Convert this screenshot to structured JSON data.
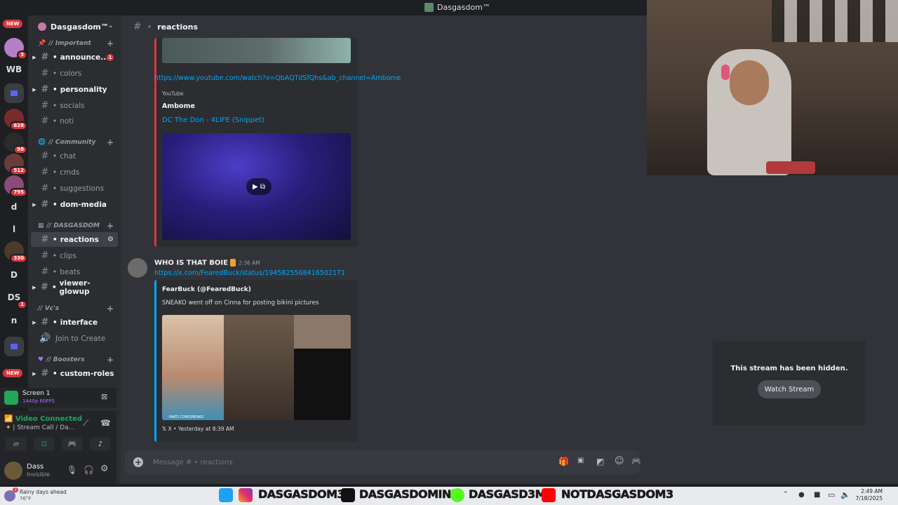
{
  "window": {
    "title": "Dasgasdom™"
  },
  "rail": {
    "new_top": "NEW",
    "new_bottom": "NEW",
    "items": [
      {
        "label": "WB"
      },
      {
        "badge": "3"
      },
      {
        "badge": "628"
      },
      {
        "badge": "98"
      },
      {
        "badge": "512"
      },
      {
        "badge": "795"
      },
      {
        "label": "d"
      },
      {
        "label": "l"
      },
      {
        "badge": "330"
      },
      {
        "label": "D"
      },
      {
        "label": "DS",
        "badge": "1"
      },
      {
        "label": "n"
      }
    ]
  },
  "server": {
    "name": "Dasgasdom™"
  },
  "categories": {
    "important": "// Important",
    "community": "// Community",
    "dasgasdom": "// DASGASDOM",
    "vcs": "// Vc's",
    "boosters": "// Boosters"
  },
  "channels": {
    "announcements": {
      "name": "announce...",
      "unread": "1"
    },
    "colors": "colors",
    "personality": "personality",
    "socials": "socials",
    "noti": "noti",
    "chat": "chat",
    "cmds": "cmds",
    "suggestions": "suggestions",
    "dom_media": "dom-media",
    "reactions": "reactions",
    "clips": "clips",
    "beats": "beats",
    "viewer_glowup": "viewer-glowup",
    "interface": "interface",
    "join_to_create": "Join to Create",
    "custom_roles": "custom-roles"
  },
  "screen_share": {
    "title": "Screen 1",
    "quality": "1440p 60FPS"
  },
  "voice": {
    "status": "Video Connected",
    "channel": "Stream Call / Da..."
  },
  "user": {
    "name": "Dass",
    "status": "Invisible"
  },
  "chat": {
    "channel": "reactions",
    "yt_link": "https://www.youtube.com/watch?v=QbAQTdSfQhs&ab_channel=Ambome",
    "yt_embed": {
      "provider": "YouTube",
      "author": "Ambome",
      "title": "DC The Don - 4LIFE (Snippet)"
    },
    "message": {
      "author": "WHO IS THAT BOIE",
      "time": "2:36 AM",
      "link": "https://x.com/FearedBuck/status/1945825568416502171"
    },
    "x_embed": {
      "author": "FearBuck (@FearedBuck)",
      "description": "SNEAKO went off on Cinna for posting bikini pictures",
      "watermark": "PARTI.COM/SNEAKO",
      "footer": "X • Yesterday at 8:39 AM"
    },
    "placeholder": "Message # • reactions"
  },
  "stream": {
    "hidden_text": "This stream has been hidden.",
    "watch_button": "Watch Stream"
  },
  "taskbar": {
    "weather_line1": "Rainy days ahead",
    "weather_line2": "76°F",
    "weather_badge": "3",
    "socials": [
      "DASGASDOM3",
      "DASGASDOMINI",
      "DASGASD3M",
      "NOTDASGASDOM3"
    ],
    "time": "2:49 AM",
    "date": "7/18/2025"
  },
  "colors": {
    "accent": "#5865f2",
    "link": "#00a8fc",
    "red": "#da373c",
    "green": "#23a55a"
  }
}
